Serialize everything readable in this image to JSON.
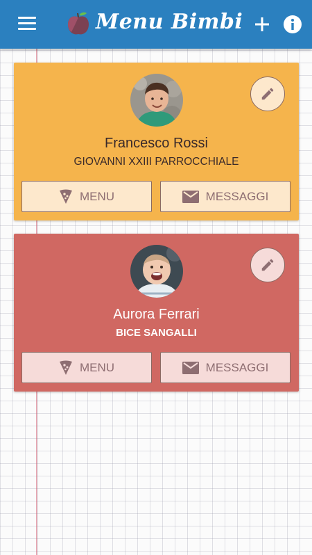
{
  "app": {
    "title": "Menu Bimbi",
    "icons": {
      "menu": "hamburger-icon",
      "logo": "apple-logo-icon",
      "add": "plus-icon",
      "info": "info-icon"
    },
    "colors": {
      "header": "#2b80bf",
      "card1": "#f5b44c",
      "card2": "#d06862"
    }
  },
  "children": [
    {
      "name": "Francesco Rossi",
      "school": "GIOVANNI XXIII PARROCCHIALE",
      "menu_label": "MENU",
      "messages_label": "MESSAGGI"
    },
    {
      "name": "Aurora Ferrari",
      "school": "BICE SANGALLI",
      "menu_label": "MENU",
      "messages_label": "MESSAGGI"
    }
  ]
}
